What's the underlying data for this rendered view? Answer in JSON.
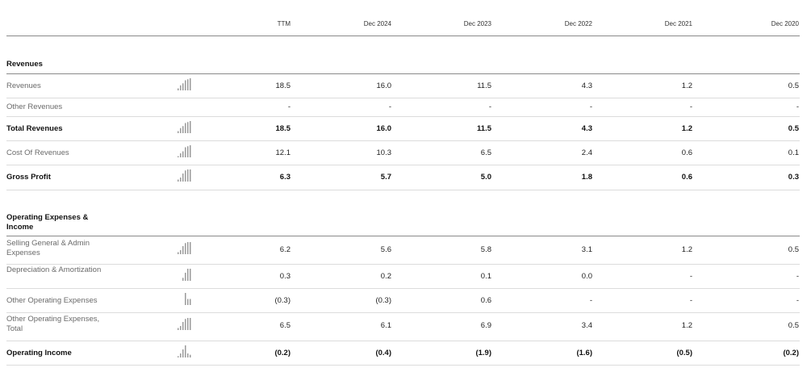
{
  "columns": [
    "TTM",
    "Dec 2024",
    "Dec 2023",
    "Dec 2022",
    "Dec 2021",
    "Dec 2020"
  ],
  "sections": [
    {
      "title": "Revenues",
      "rows": [
        {
          "label": "Revenues",
          "bold": false,
          "spark": [
            2,
            5,
            7,
            10,
            11,
            12
          ],
          "values": [
            "18.5",
            "16.0",
            "11.5",
            "4.3",
            "1.2",
            "0.5"
          ]
        },
        {
          "label": "Other Revenues",
          "bold": false,
          "spark": null,
          "values": [
            "-",
            "-",
            "-",
            "-",
            "-",
            "-"
          ]
        },
        {
          "label": "Total Revenues",
          "bold": true,
          "spark": [
            2,
            5,
            7,
            10,
            11,
            12
          ],
          "values": [
            "18.5",
            "16.0",
            "11.5",
            "4.3",
            "1.2",
            "0.5"
          ]
        },
        {
          "label": "Cost Of Revenues",
          "bold": false,
          "spark": [
            1,
            4,
            6,
            10,
            11,
            12
          ],
          "values": [
            "12.1",
            "10.3",
            "6.5",
            "2.4",
            "0.6",
            "0.1"
          ]
        },
        {
          "label": "Gross Profit",
          "bold": true,
          "spark": [
            2,
            4,
            8,
            11,
            12,
            12
          ],
          "values": [
            "6.3",
            "5.7",
            "5.0",
            "1.8",
            "0.6",
            "0.3"
          ]
        }
      ]
    },
    {
      "title": "Operating Expenses & Income",
      "rows": [
        {
          "label": "Selling General & Admin Expenses",
          "bold": false,
          "spark": [
            2,
            4,
            8,
            11,
            12,
            12
          ],
          "values": [
            "6.2",
            "5.6",
            "5.8",
            "3.1",
            "1.2",
            "0.5"
          ]
        },
        {
          "label": "Depreciation & Amortization",
          "bold": false,
          "spark": [
            0,
            0,
            3,
            8,
            12,
            12
          ],
          "values": [
            "0.3",
            "0.2",
            "0.1",
            "0.0",
            "-",
            "-"
          ]
        },
        {
          "label": "Other Operating Expenses",
          "bold": false,
          "spark": [
            0,
            0,
            0,
            4,
            2,
            2
          ],
          "values": [
            "(0.3)",
            "(0.3)",
            "0.6",
            "-",
            "-",
            "-"
          ]
        },
        {
          "label": "Other Operating Expenses, Total",
          "bold": false,
          "spark": [
            2,
            4,
            8,
            11,
            12,
            12
          ],
          "values": [
            "6.5",
            "6.1",
            "6.9",
            "3.4",
            "1.2",
            "0.5"
          ]
        },
        {
          "label": "Operating Income",
          "bold": true,
          "spark": [
            1,
            3,
            6,
            9,
            3,
            2
          ],
          "values": [
            "(0.2)",
            "(0.4)",
            "(1.9)",
            "(1.6)",
            "(0.5)",
            "(0.2)"
          ]
        }
      ]
    }
  ]
}
